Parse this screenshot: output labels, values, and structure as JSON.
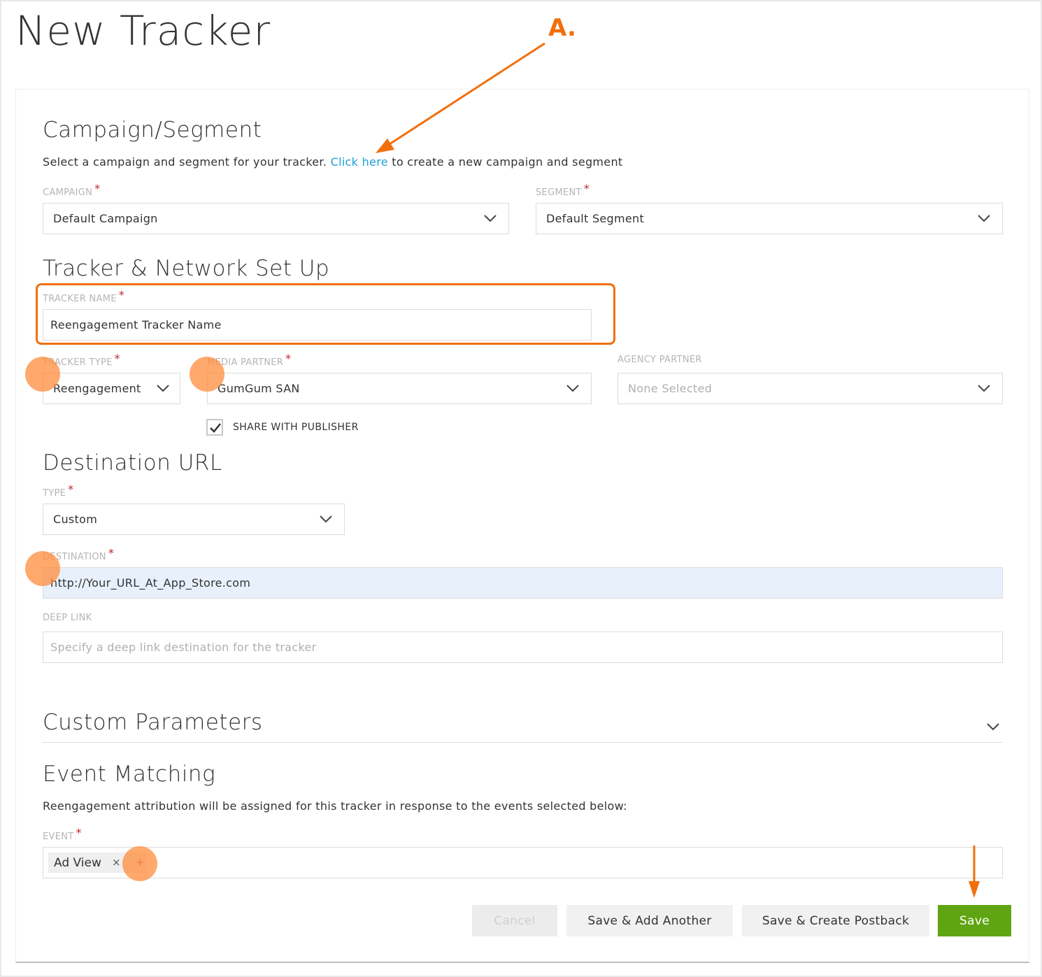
{
  "page_title": "New Tracker",
  "annotation": {
    "label": "A.",
    "color": "#f26f0e"
  },
  "campaign_segment": {
    "heading": "Campaign/Segment",
    "description_before": "Select a campaign and segment for your tracker. ",
    "link_text": "Click here",
    "description_after": " to create a new campaign and segment",
    "campaign_label": "CAMPAIGN",
    "campaign_value": "Default Campaign",
    "segment_label": "SEGMENT",
    "segment_value": "Default Segment"
  },
  "tracker_network": {
    "heading": "Tracker & Network Set Up",
    "tracker_name_label": "TRACKER NAME",
    "tracker_name_value": "Reengagement Tracker Name",
    "tracker_type_label": "TRACKER TYPE",
    "tracker_type_value": "Reengagement",
    "media_partner_label": "MEDIA PARTNER",
    "media_partner_value": "GumGum SAN",
    "agency_partner_label": "AGENCY PARTNER",
    "agency_partner_placeholder": "None Selected",
    "share_with_publisher_label": "SHARE WITH PUBLISHER",
    "share_with_publisher_checked": true
  },
  "destination_url": {
    "heading": "Destination URL",
    "type_label": "TYPE",
    "type_value": "Custom",
    "destination_label": "DESTINATION",
    "destination_value": "http://Your_URL_At_App_Store.com",
    "deep_link_label": "DEEP LINK",
    "deep_link_placeholder": "Specify a deep link destination for the tracker"
  },
  "custom_parameters": {
    "heading": "Custom Parameters"
  },
  "event_matching": {
    "heading": "Event Matching",
    "description": "Reengagement attribution will be assigned for this tracker in response to the events selected below:",
    "event_label": "EVENT",
    "events": [
      "Ad View"
    ],
    "remove_symbol": "×",
    "add_symbol": "+"
  },
  "required_marker": "*",
  "buttons": {
    "cancel": "Cancel",
    "save_add_another": "Save & Add Another",
    "save_create_postback": "Save & Create Postback",
    "save": "Save"
  },
  "colors": {
    "accent_orange": "#f26f0e",
    "link_blue": "#1e9fd6",
    "save_green": "#5fa513",
    "required_red": "#c0262e"
  }
}
